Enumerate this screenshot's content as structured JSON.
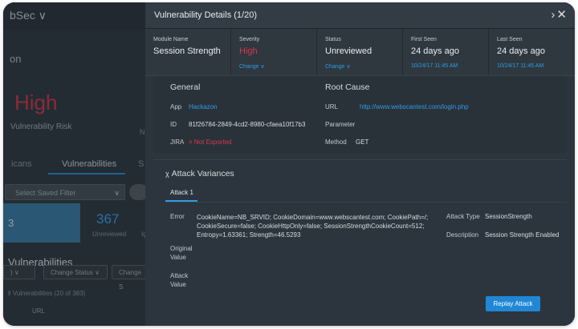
{
  "background": {
    "app_name": "bSec ∨",
    "page_title": "on",
    "risk_level": "High",
    "risk_label": "Vulnerability Risk",
    "risk_side": "N",
    "tabs": [
      "icans",
      "Vulnerabilities",
      "S"
    ],
    "filter_placeholder": "Select Saved Filter",
    "vuln_box": "3 Vulnerabilities",
    "unreviewed_count": "367",
    "unreviewed_label": "Unreviewed",
    "unreviewed_label_2": "Ig",
    "buttons": [
      "Change Status",
      "Change S"
    ],
    "all_label": "ll Vulnerabilities (20 of 383)",
    "column_url": "URL",
    "colors": {
      "high": "#d23a52",
      "accent": "#2b8ed6"
    }
  },
  "modal": {
    "title": "Vulnerability Details (1/20)",
    "nav": "> ×",
    "meta": [
      {
        "label": "Module Name",
        "value": "Session Strength",
        "sub": ""
      },
      {
        "label": "Severity",
        "value": "High",
        "sub": "Change ∨"
      },
      {
        "label": "Status",
        "value": "Unreviewed",
        "sub": "Change ∨"
      },
      {
        "label": "First Seen",
        "value": "24 days ago",
        "sub": "10/24/17 11:45 AM"
      },
      {
        "label": "Last Seen",
        "value": "24 days ago",
        "sub": "10/24/17 11:45 AM"
      }
    ],
    "general": {
      "title": "General",
      "app_label": "App",
      "app_value": "Hackazon",
      "id_label": "ID",
      "id_value": "81f26784-2849-4cd2-8980-cfaea10f17b3",
      "jira_label": "JIRA",
      "jira_value": "× Not Exported"
    },
    "root_cause": {
      "title": "Root Cause",
      "url_label": "URL",
      "url_value": "http://www.webscantest.com/login.php",
      "param_label": "Parameter",
      "method_label": "Method",
      "method_value": "GET"
    },
    "attack": {
      "title": "Attack Variances",
      "tab": "Attack 1",
      "error_label": "Error",
      "error_value": "CookieName=NB_SRVID; CookieDomain=www.webscantest.com; CookiePath=/; CookieSecure=false; CookieHttpOnly=false; SessionStrengthCookieCount=512; Entropy=1.63361; Strength=46.5293",
      "original_label": "Original Value",
      "attack_value_label": "Attack Value",
      "type_label": "Attack Type",
      "type_value": "SessionStrength",
      "desc_label": "Description",
      "desc_value": "Session Strength Enabled",
      "replay_label": "Replay Attack"
    }
  }
}
